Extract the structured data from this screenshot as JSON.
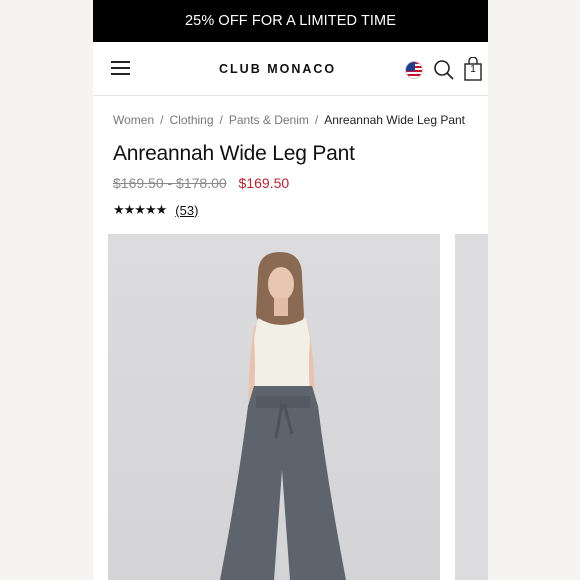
{
  "promo": {
    "text": "25% OFF FOR A LIMITED TIME"
  },
  "header": {
    "logo": "CLUB MONACO",
    "bag_count": "1"
  },
  "breadcrumb": {
    "items": [
      "Women",
      "Clothing",
      "Pants & Denim"
    ],
    "current": "Anreannah Wide Leg Pant",
    "separator": "/"
  },
  "product": {
    "title": "Anreannah Wide Leg Pant",
    "original_price_range": "$169.50 - $178.00",
    "sale_price": "$169.50",
    "rating": {
      "stars": "★★★★★",
      "value": 4.5,
      "review_count": "(53)"
    }
  },
  "colors": {
    "sale": "#b8222f",
    "promo_bg": "#000000",
    "pants": "#5d646d"
  }
}
